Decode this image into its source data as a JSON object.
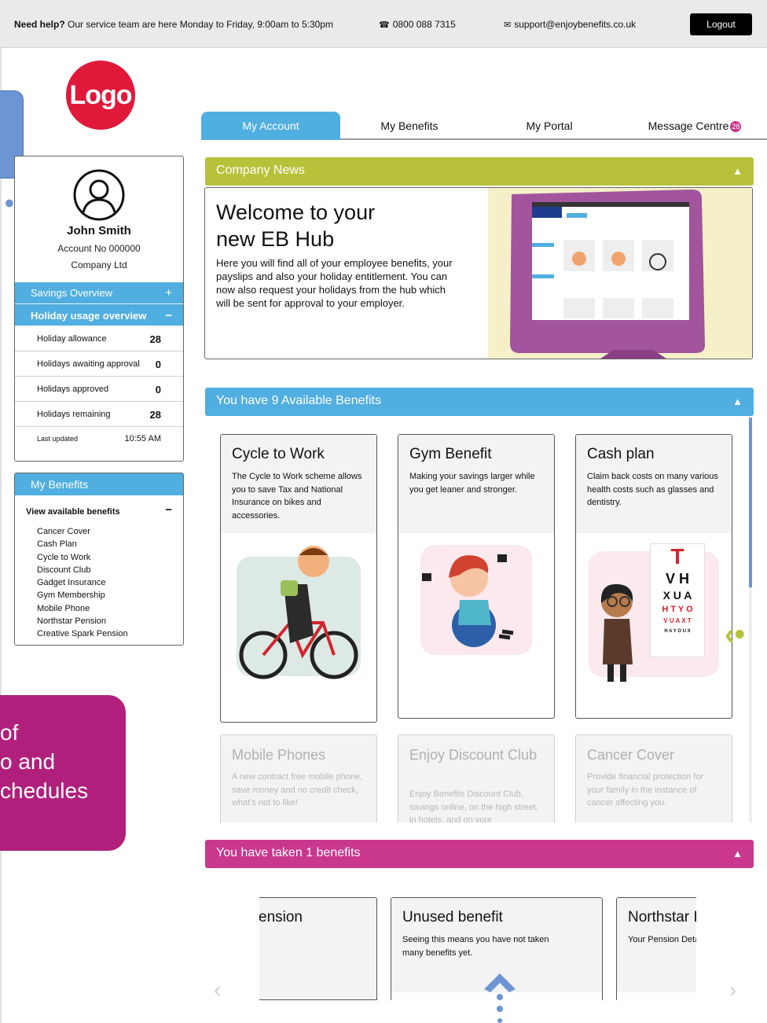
{
  "topbar": {
    "help_bold": "Need help?",
    "help_text": "Our service team are here Monday to Friday, 9:00am to 5:30pm",
    "phone": "0800 088 7315",
    "email": "support@enjoybenefits.co.uk",
    "logout_label": "Logout"
  },
  "logo_text": "Logo",
  "nav": {
    "tabs": [
      {
        "label": "My Account"
      },
      {
        "label": "My Benefits"
      },
      {
        "label": "My Portal"
      },
      {
        "label": "Message Centre"
      }
    ],
    "message_count": "28"
  },
  "profile": {
    "name": "John Smith",
    "account": "Account No 000000",
    "company": "Company Ltd"
  },
  "accordion": {
    "savings_label": "Savings Overview",
    "savings_sign": "+",
    "holiday_label": "Holiday usage overview",
    "holiday_sign": "−"
  },
  "holiday": {
    "rows": [
      {
        "label": "Holiday allowance",
        "value": "28"
      },
      {
        "label": "Holidays awaiting approval",
        "value": "0"
      },
      {
        "label": "Holidays approved",
        "value": "0"
      },
      {
        "label": "Holidays remaining",
        "value": "28"
      }
    ],
    "last_updated_label": "Last updated",
    "last_updated_value": "10:55 AM"
  },
  "my_benefits": {
    "title": "My Benefits",
    "view_label": "View available benefits",
    "view_sign": "−",
    "items": [
      "Cancer Cover",
      "Cash Plan",
      "Cycle to Work",
      "Discount Club",
      "Gadget Insurance",
      "Gym Membership",
      "Mobile Phone",
      "Northstar Pension",
      "Creative Spark Pension"
    ]
  },
  "purple_deco": {
    "lines": [
      "of",
      "o and",
      "chedules"
    ]
  },
  "news": {
    "section_title": "Company News",
    "heading": "Welcome to your new EB Hub",
    "body": "Here you will find all of your employee benefits, your payslips and also your holiday entitlement. You can now also request your holidays from the hub which will be sent for approval to your employer."
  },
  "available": {
    "section_title": "You have 9 Available Benefits",
    "cards": [
      {
        "title": "Cycle to Work",
        "desc": "The Cycle to Work scheme allows you to save Tax and National Insurance on bikes and accessories."
      },
      {
        "title": "Gym Benefit",
        "desc": "Making your savings larger while you get leaner and stronger."
      },
      {
        "title": "Cash plan",
        "desc": "Claim back costs on many various health costs such as glasses and dentistry."
      },
      {
        "title": "Mobile Phones",
        "desc": "A new contract free mobile phone, save money and no credit check, what's not to like!"
      },
      {
        "title": "Enjoy Discount Club",
        "desc": "Enjoy Benefits Discount Club, savings online, on the high street, in hotels, and on your"
      },
      {
        "title": "Cancer Cover",
        "desc": "Provide financial protection for your family in the instance of cancer affecting you."
      }
    ],
    "eye_chart": [
      "T",
      "V H",
      "X U A",
      "H T Y O",
      "V U A X T",
      "H A Y O U X"
    ]
  },
  "taken": {
    "section_title": "You have taken 1 benefits",
    "cards": [
      {
        "title": "ension",
        "desc": ""
      },
      {
        "title": "Unused benefit",
        "desc": "Seeing this means you have not taken many benefits yet."
      },
      {
        "title": "Northstar I",
        "desc": "Your Pension Deta"
      }
    ]
  },
  "icons": {
    "chevron_up": "▲",
    "chevron_left": "‹",
    "chevron_right": "›"
  },
  "colors": {
    "accent_blue": "#50aee0",
    "news_green": "#b7c23a",
    "taken_pink": "#c9378e",
    "logo_red": "#e0193a"
  }
}
